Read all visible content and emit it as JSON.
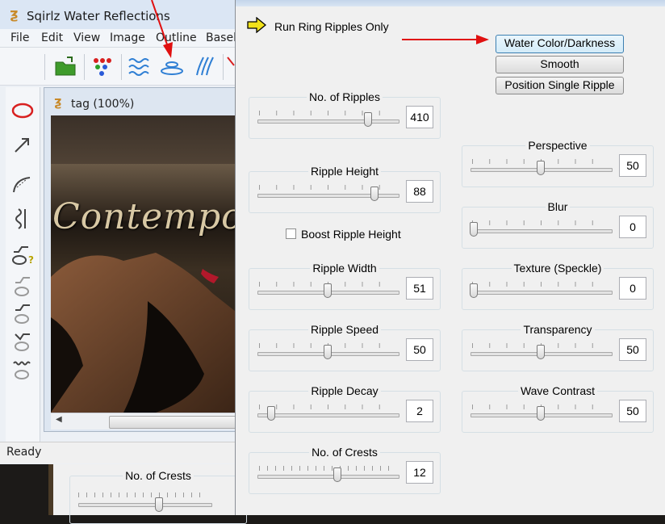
{
  "main_window": {
    "title": "Sqirlz Water Reflections",
    "menu": [
      "File",
      "Edit",
      "View",
      "Image",
      "Outline",
      "Basel"
    ],
    "document_title": "tag  (100%)",
    "image_text": "Contemporary",
    "status": "Ready"
  },
  "back_window": {
    "crests_label": "No. of Crests"
  },
  "dialog": {
    "run_label": "Run Ring Ripples Only",
    "buttons": {
      "water_color": "Water Color/Darkness",
      "smooth": "Smooth",
      "position_single": "Position Single Ripple"
    },
    "boost_label": "Boost Ripple Height",
    "boost_checked": false,
    "sliders_left": [
      {
        "label": "No. of Ripples",
        "value": "410",
        "level": 0.8
      },
      {
        "label": "Ripple Height",
        "value": "88",
        "level": 0.85
      },
      {
        "label": "Ripple Width",
        "value": "51",
        "level": 0.5
      },
      {
        "label": "Ripple Speed",
        "value": "50",
        "level": 0.5
      },
      {
        "label": "Ripple Decay",
        "value": "2",
        "level": 0.08
      },
      {
        "label": "No. of Crests",
        "value": "12",
        "level": 0.57
      }
    ],
    "sliders_right": [
      {
        "label": "Perspective",
        "value": "50",
        "level": 0.5
      },
      {
        "label": "Blur",
        "value": "0",
        "level": 0.0
      },
      {
        "label": "Texture (Speckle)",
        "value": "0",
        "level": 0.0
      },
      {
        "label": "Transparency",
        "value": "50",
        "level": 0.5
      },
      {
        "label": "Wave Contrast",
        "value": "50",
        "level": 0.5
      }
    ]
  },
  "colors": {
    "annotation_arrow": "#e01010",
    "run_arrow": "#f2e21a",
    "toolbar_blue": "#2f7fd4"
  }
}
